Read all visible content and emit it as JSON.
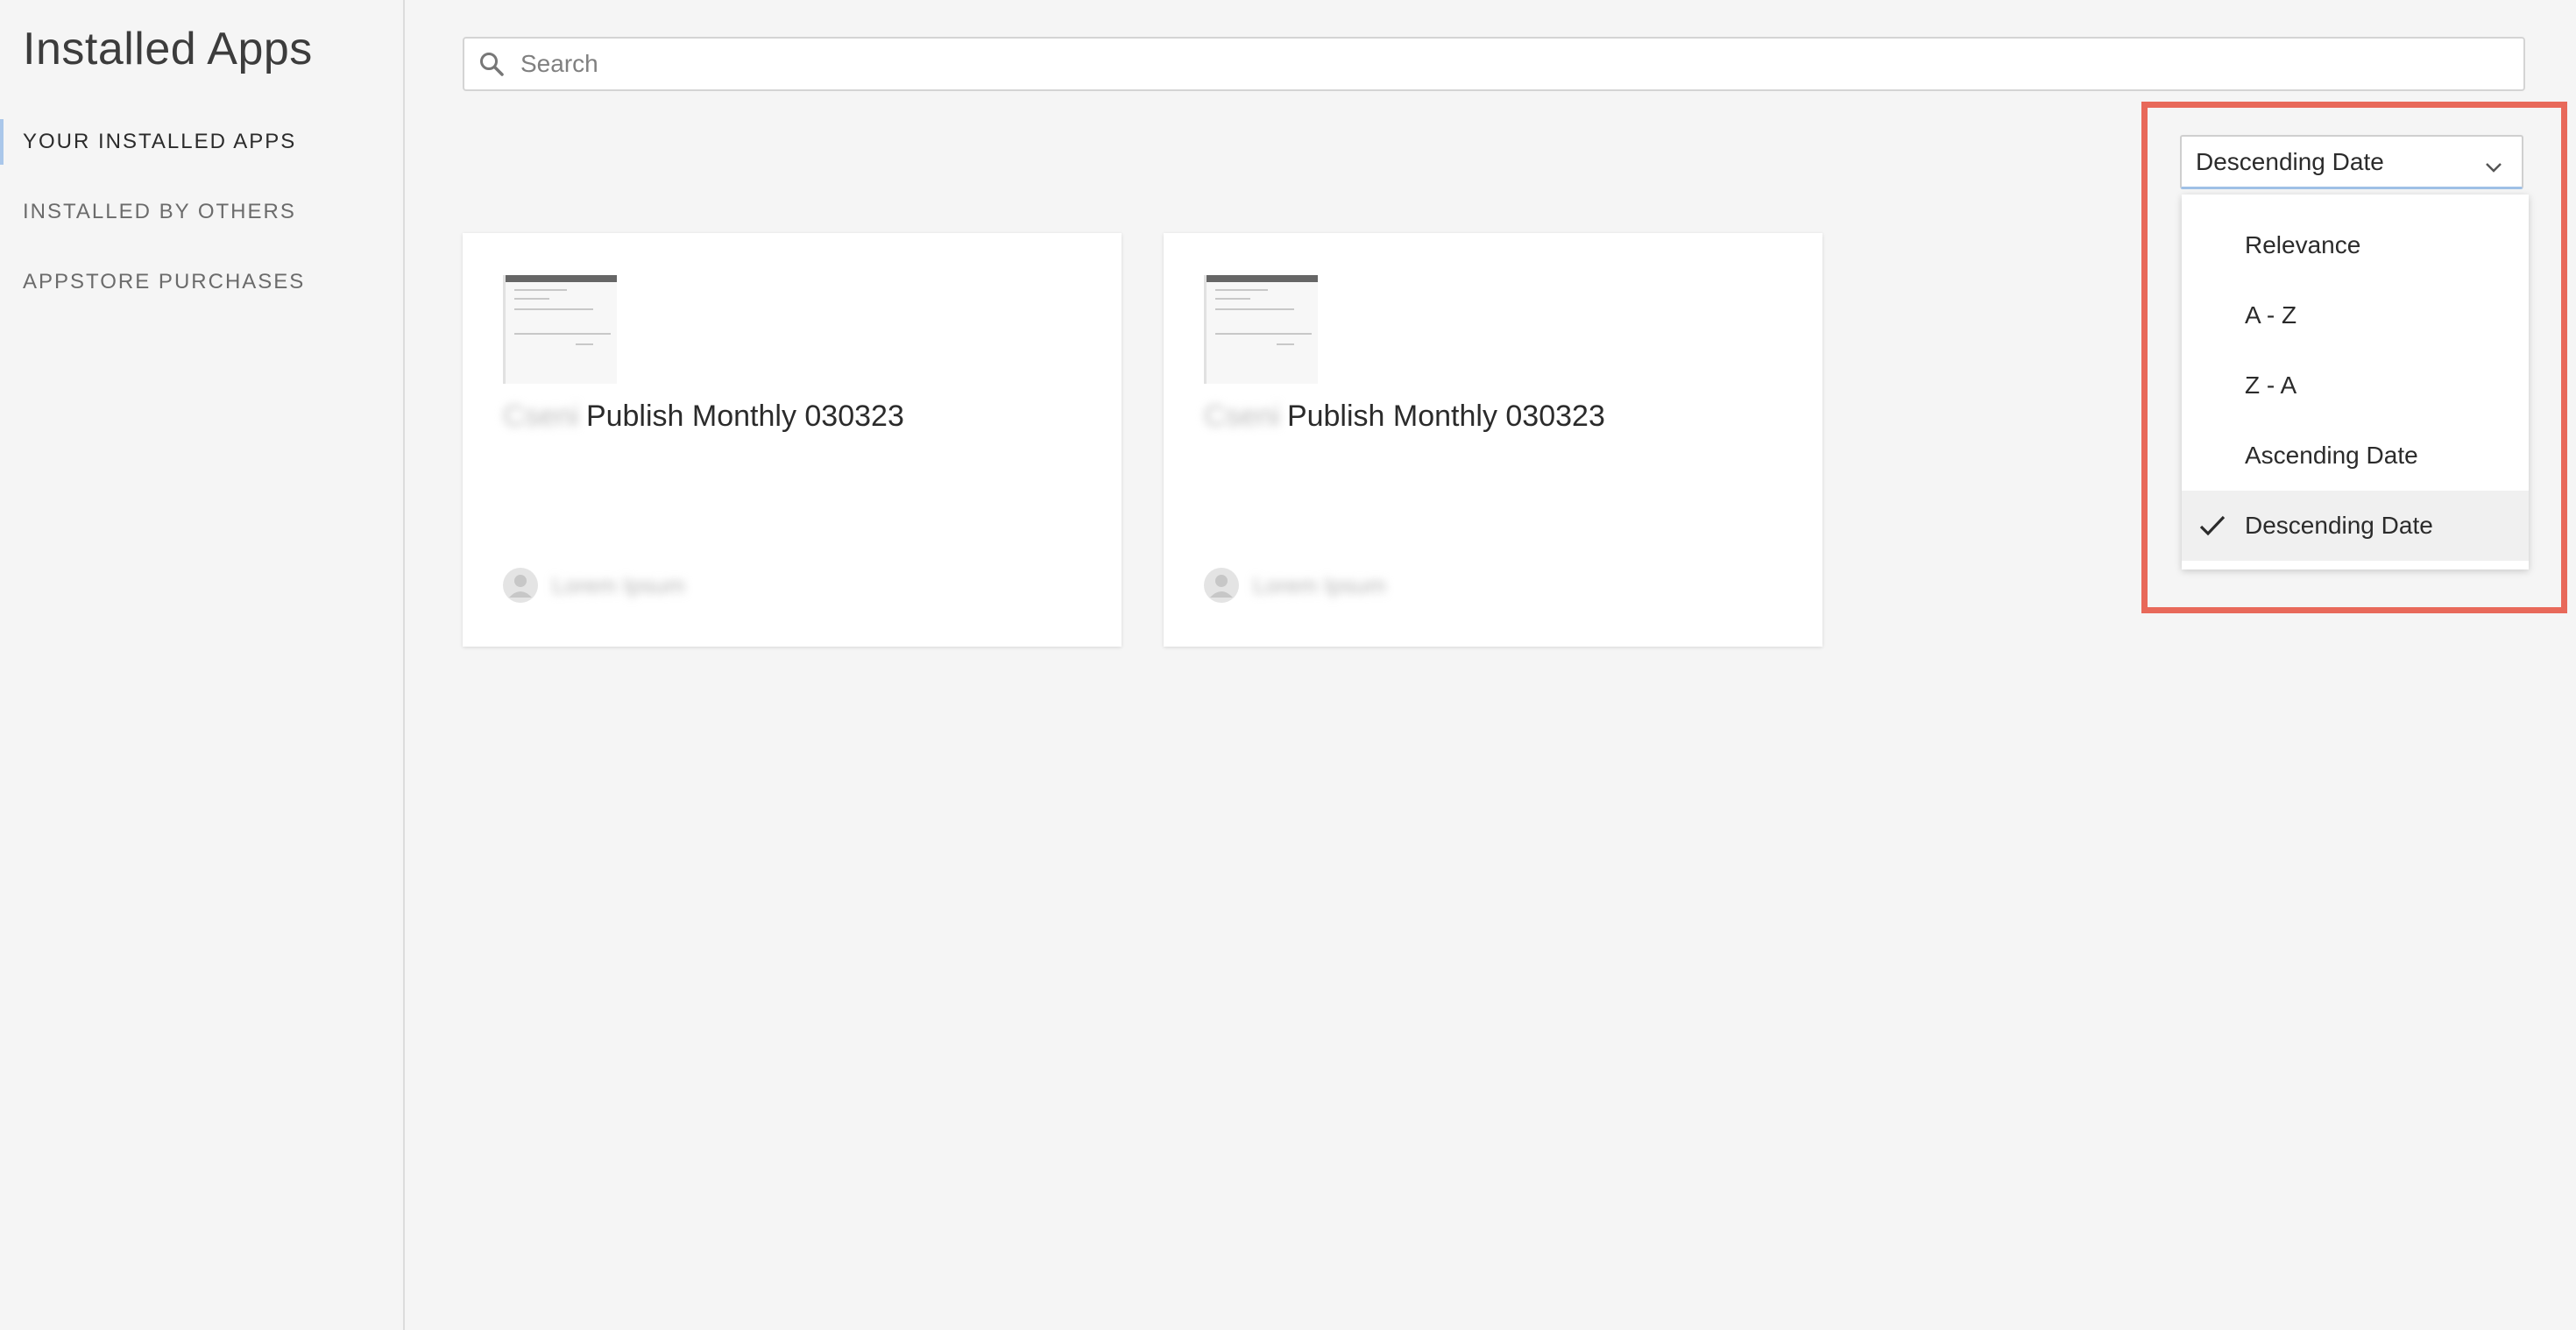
{
  "sidebar": {
    "title": "Installed Apps",
    "items": [
      {
        "label": "YOUR INSTALLED APPS",
        "active": true
      },
      {
        "label": "INSTALLED BY OTHERS",
        "active": false
      },
      {
        "label": "APPSTORE PURCHASES",
        "active": false
      }
    ]
  },
  "search": {
    "placeholder": "Search",
    "value": "",
    "icon": "search-icon"
  },
  "sort": {
    "selected": "Descending Date",
    "options": [
      {
        "label": "Relevance",
        "selected": false
      },
      {
        "label": "A - Z",
        "selected": false
      },
      {
        "label": "Z - A",
        "selected": false
      },
      {
        "label": "Ascending Date",
        "selected": false
      },
      {
        "label": "Descending Date",
        "selected": true
      }
    ]
  },
  "cards": [
    {
      "title_prefix": "Cseni",
      "title": "Publish Monthly 030323",
      "author": "Lorem Ipsum"
    },
    {
      "title_prefix": "Cseni",
      "title": "Publish Monthly 030323",
      "author": "Lorem Ipsum"
    }
  ],
  "colors": {
    "highlight": "#e8695a",
    "active_indicator": "#aac7ea",
    "background": "#f5f5f5"
  }
}
